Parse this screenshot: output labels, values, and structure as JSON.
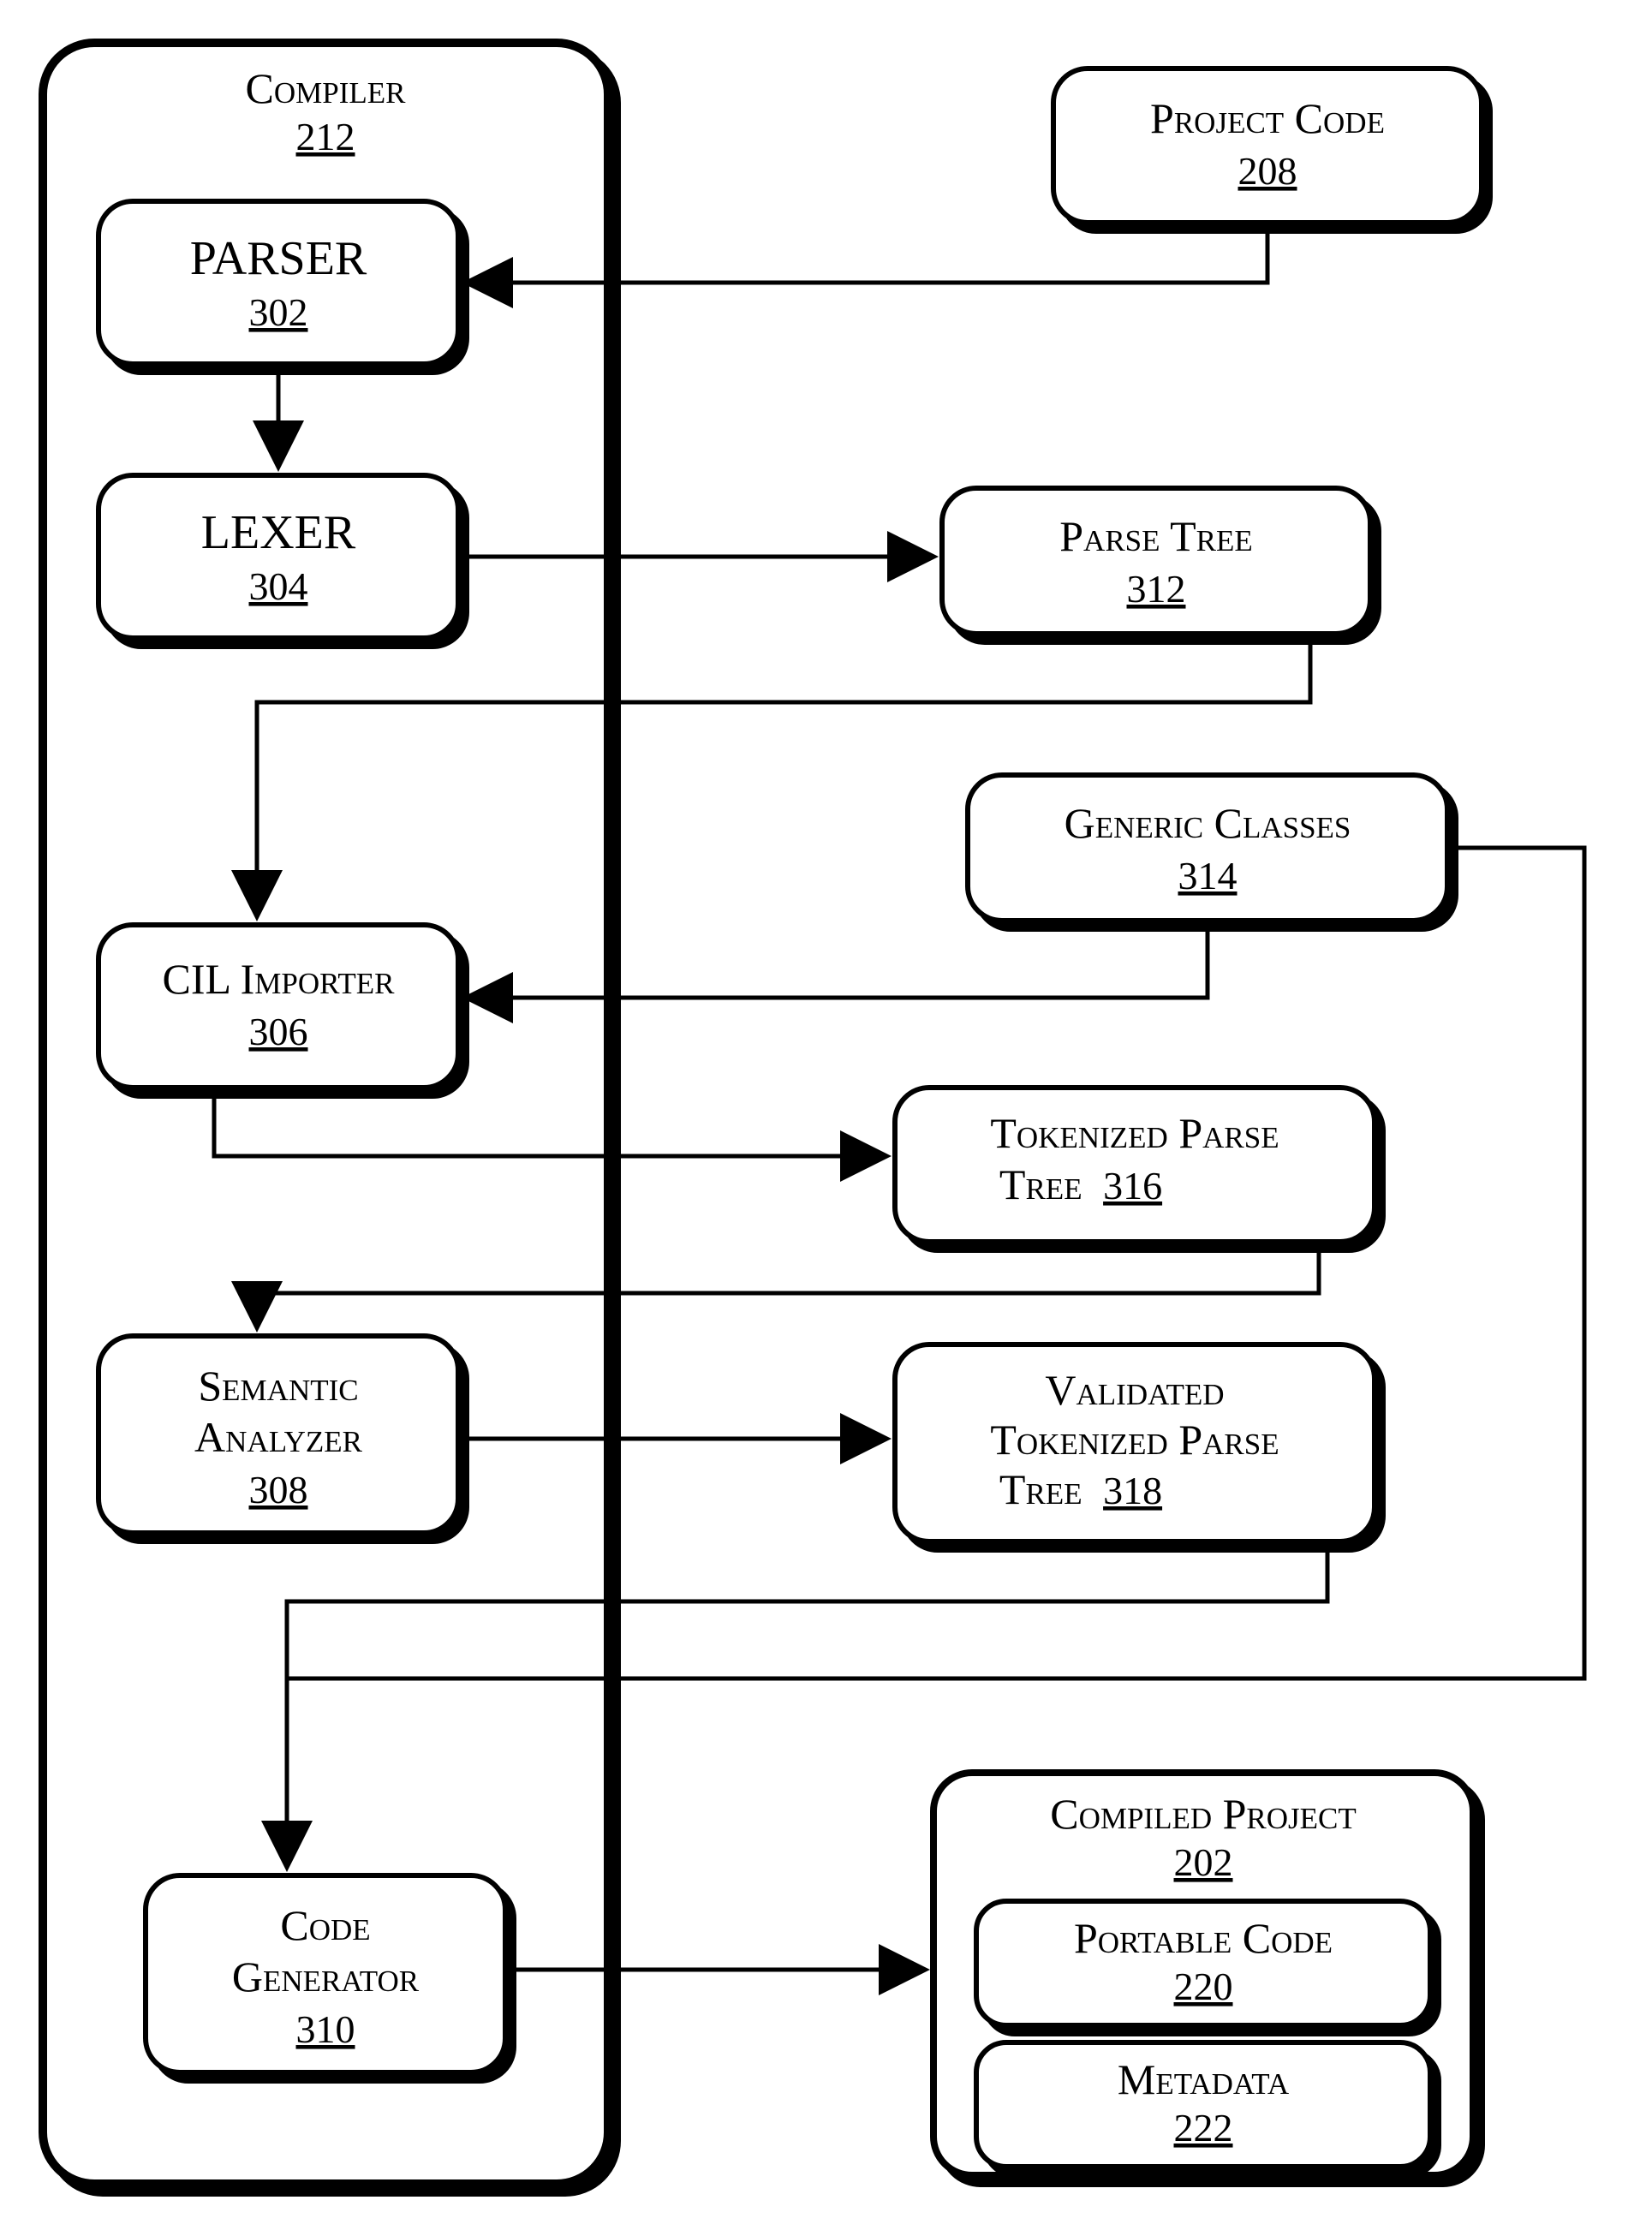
{
  "compiler": {
    "title": "Compiler",
    "num": "212"
  },
  "parser": {
    "title": "PARSER",
    "num": "302"
  },
  "lexer": {
    "title": "LEXER",
    "num": "304"
  },
  "cil": {
    "title": "CIL Importer",
    "num": "306"
  },
  "semantic": {
    "title1": "Semantic",
    "title2": "Analyzer",
    "num": "308"
  },
  "codegen": {
    "title1": "Code",
    "title2": "Generator",
    "num": "310"
  },
  "projectCode": {
    "title": "Project Code",
    "num": "208"
  },
  "parseTree": {
    "title": "Parse Tree",
    "num": "312"
  },
  "genericClasses": {
    "title": "Generic Classes",
    "num": "314"
  },
  "tokParseTree": {
    "title1": "Tokenized Parse",
    "title2": "Tree",
    "num": "316"
  },
  "valTokParseTree": {
    "title1": "Validated",
    "title2": "Tokenized Parse",
    "title3": "Tree",
    "num": "318"
  },
  "compiledProject": {
    "title": "Compiled Project",
    "num": "202"
  },
  "portableCode": {
    "title": "Portable Code",
    "num": "220"
  },
  "metadata": {
    "title": "Metadata",
    "num": "222"
  }
}
